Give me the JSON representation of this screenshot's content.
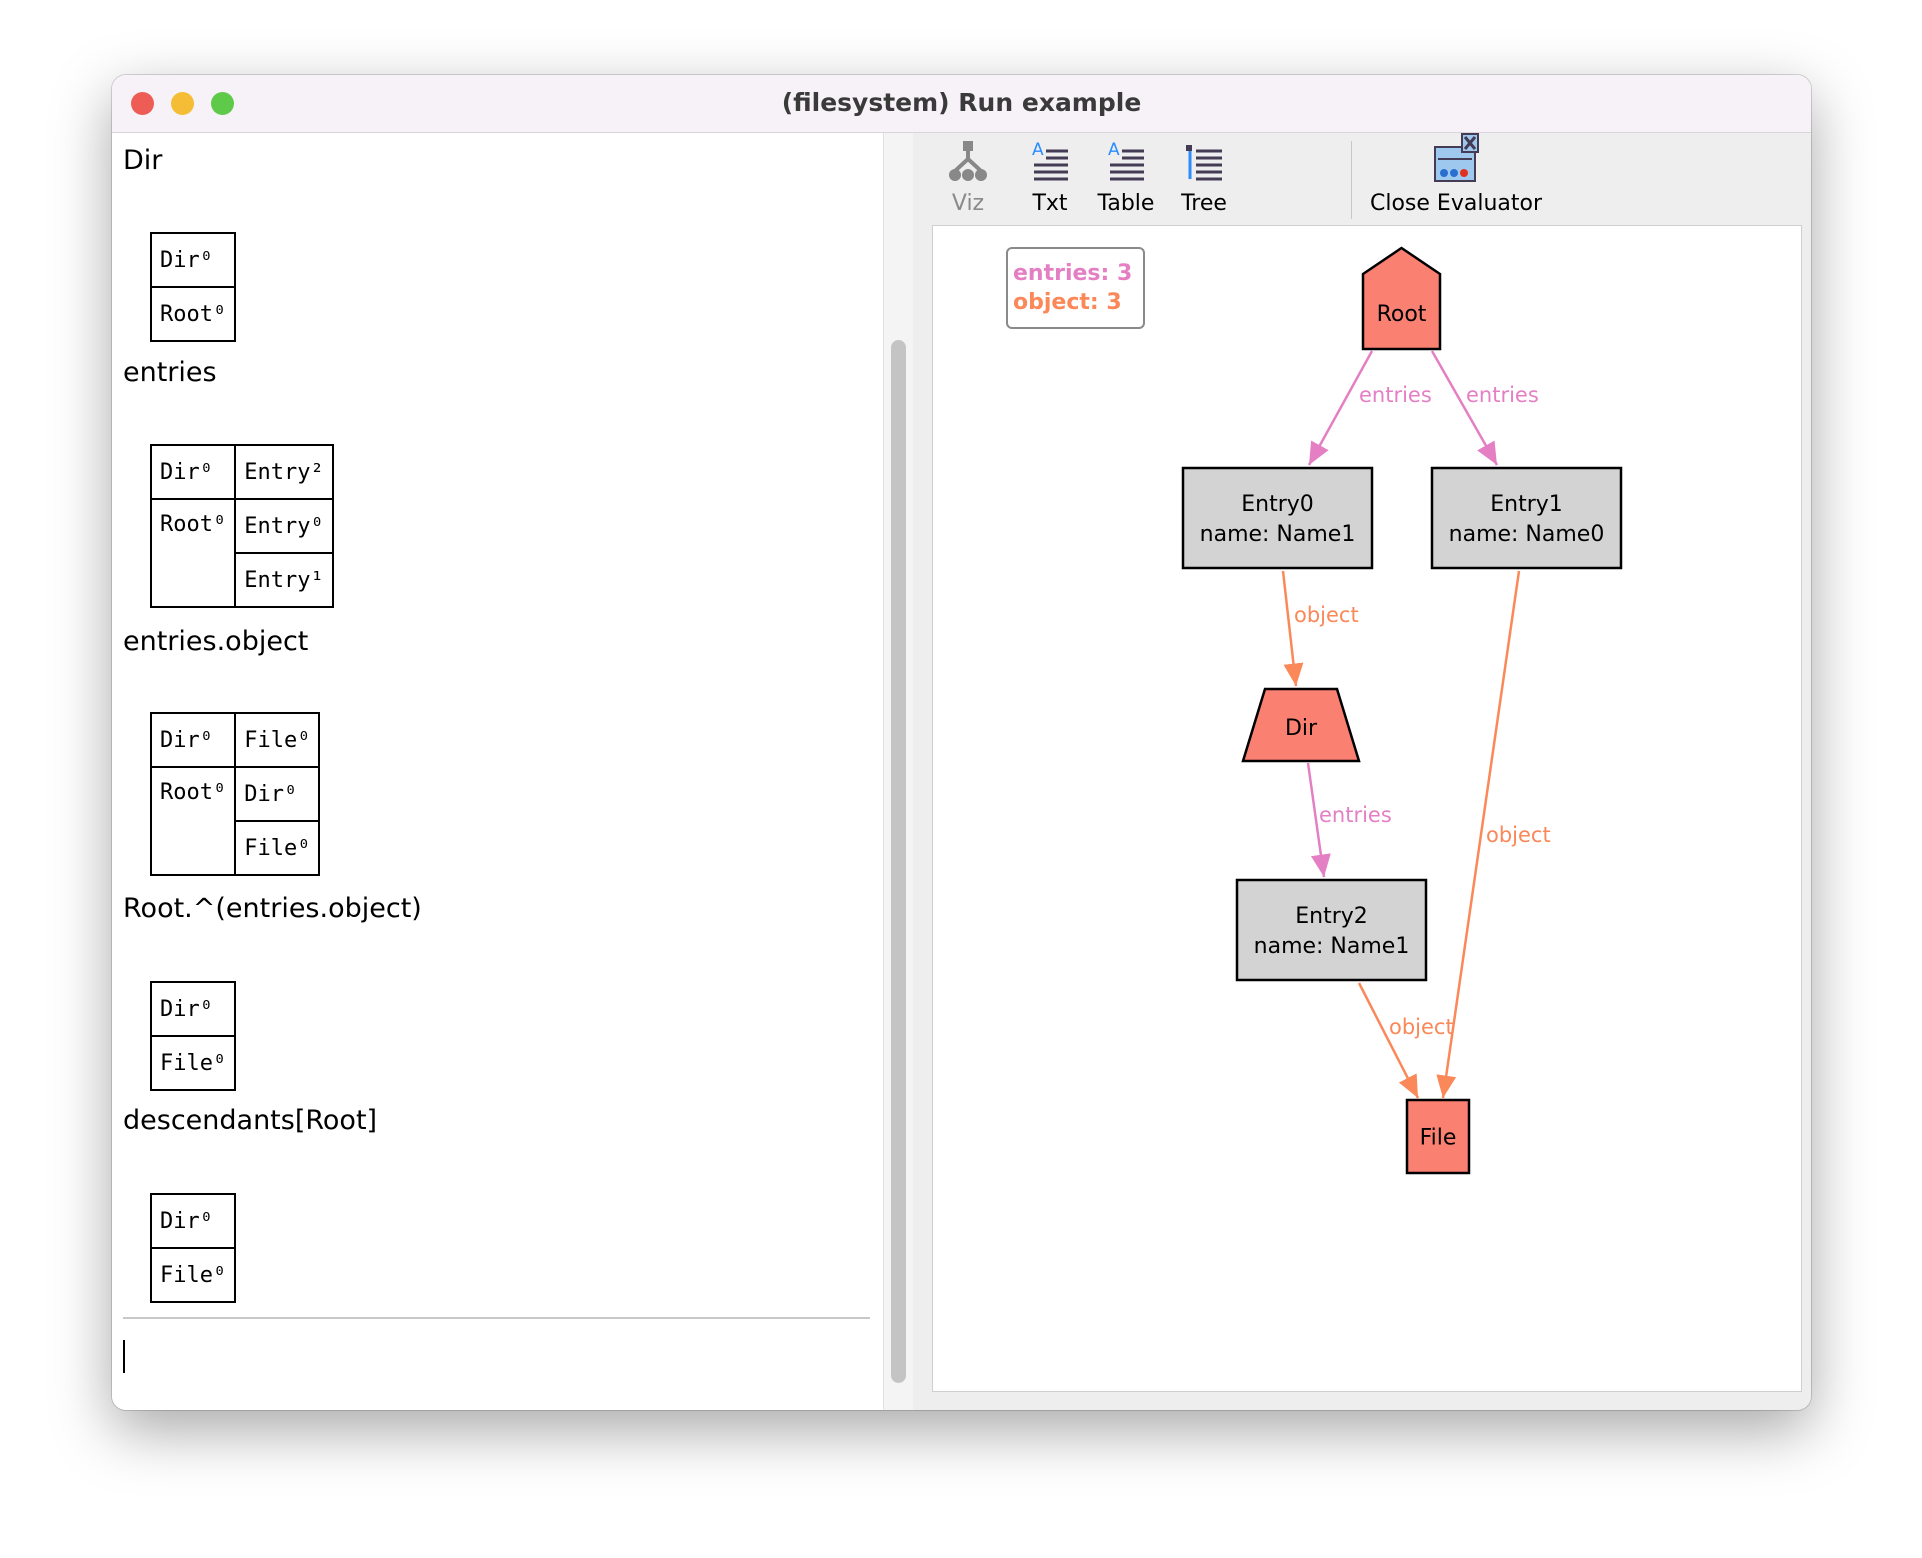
{
  "window": {
    "title": "(filesystem) Run example"
  },
  "toolbar": {
    "viz": "Viz",
    "txt": "Txt",
    "table": "Table",
    "tree": "Tree",
    "close": "Close Evaluator"
  },
  "results": [
    {
      "label": "Dir",
      "rows": [
        [
          "Dir⁰"
        ],
        [
          "Root⁰"
        ]
      ]
    },
    {
      "label": "entries",
      "rows": [
        [
          "Dir⁰",
          "Entry²"
        ],
        [
          "Root⁰",
          "Entry⁰"
        ],
        [
          "",
          "Entry¹"
        ]
      ]
    },
    {
      "label": "entries.object",
      "rows": [
        [
          "Dir⁰",
          "File⁰"
        ],
        [
          "Root⁰",
          "Dir⁰"
        ],
        [
          "",
          "File⁰"
        ]
      ]
    },
    {
      "label": "Root.^(entries.object)",
      "rows": [
        [
          "Dir⁰"
        ],
        [
          "File⁰"
        ]
      ]
    },
    {
      "label": "descendants[Root]",
      "rows": [
        [
          "Dir⁰"
        ],
        [
          "File⁰"
        ]
      ]
    }
  ],
  "legend": {
    "entries": "entries: 3",
    "object": "object: 3"
  },
  "colors": {
    "entries": "#e57fc4",
    "object": "#fa8859",
    "node_fill": "#fa8072",
    "box_fill": "#d3d3d3"
  },
  "graph": {
    "nodes": [
      {
        "id": "Root",
        "lines": [
          "Root"
        ],
        "shape": "house"
      },
      {
        "id": "Entry0",
        "lines": [
          "Entry0",
          "name: Name1"
        ],
        "shape": "box"
      },
      {
        "id": "Entry1",
        "lines": [
          "Entry1",
          "name: Name0"
        ],
        "shape": "box"
      },
      {
        "id": "Dir",
        "lines": [
          "Dir"
        ],
        "shape": "trapezium"
      },
      {
        "id": "Entry2",
        "lines": [
          "Entry2",
          "name: Name1"
        ],
        "shape": "box"
      },
      {
        "id": "File",
        "lines": [
          "File"
        ],
        "shape": "rect"
      }
    ],
    "edges": [
      {
        "from": "Root",
        "to": "Entry0",
        "label": "entries"
      },
      {
        "from": "Root",
        "to": "Entry1",
        "label": "entries"
      },
      {
        "from": "Entry0",
        "to": "Dir",
        "label": "object"
      },
      {
        "from": "Dir",
        "to": "Entry2",
        "label": "entries"
      },
      {
        "from": "Entry1",
        "to": "File",
        "label": "object"
      },
      {
        "from": "Entry2",
        "to": "File",
        "label": "object"
      }
    ]
  }
}
